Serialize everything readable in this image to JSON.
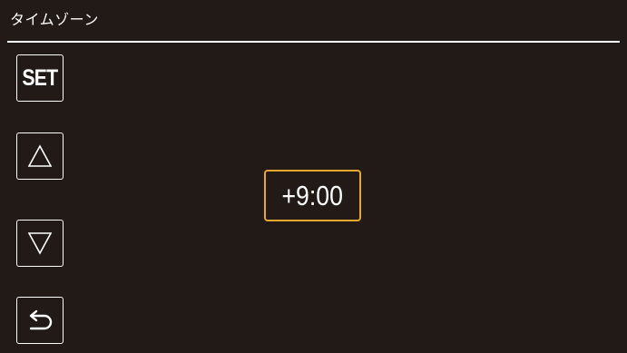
{
  "header": {
    "title": "タイムゾーン"
  },
  "buttons": {
    "set_label": "SET",
    "up_icon": "up-triangle-icon",
    "down_icon": "down-triangle-icon",
    "back_icon": "return-arrow-icon"
  },
  "timezone": {
    "value": "+9:00"
  },
  "colors": {
    "background": "#211a16",
    "foreground": "#ffffff",
    "highlight_border": "#e6a82e"
  }
}
